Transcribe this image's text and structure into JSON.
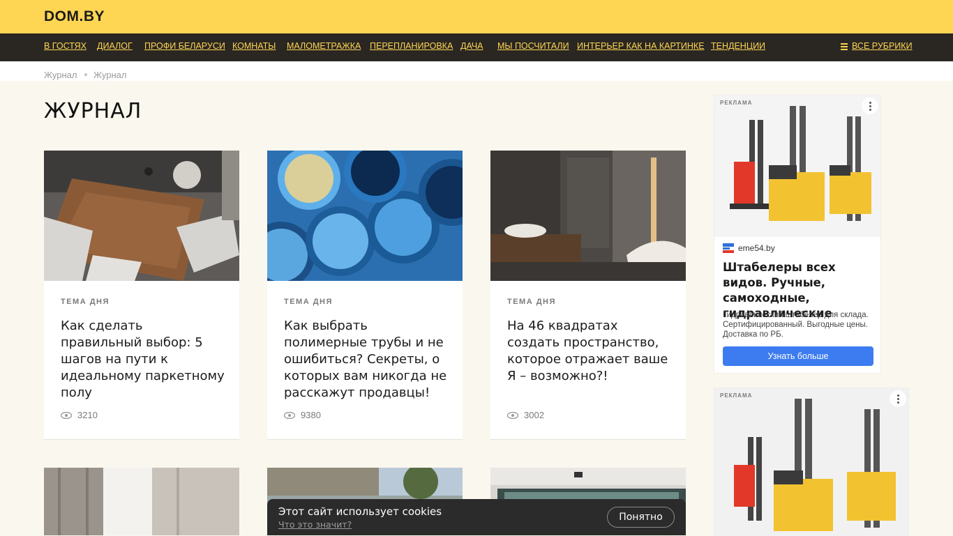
{
  "header": {
    "logo": "DOM.BY"
  },
  "nav": {
    "items": [
      {
        "label": "В ГОСТЯХ"
      },
      {
        "label": "ДИАЛОГ"
      },
      {
        "label": "ПРОФИ БЕЛАРУСИ"
      },
      {
        "label": "КОМНАТЫ"
      },
      {
        "label": "МАЛОМЕТРАЖКА"
      },
      {
        "label": "ПЕРЕПЛАНИРОВКА"
      },
      {
        "label": "ДАЧА"
      },
      {
        "label": "МЫ ПОСЧИТАЛИ"
      },
      {
        "label": "ИНТЕРЬЕР КАК НА КАРТИНКЕ"
      },
      {
        "label": "ТЕНДЕНЦИИ"
      }
    ],
    "all_rubrics": "ВСЕ РУБРИКИ"
  },
  "breadcrumb": [
    "Журнал",
    "Журнал"
  ],
  "page_title": "ЖУРНАЛ",
  "cards": [
    {
      "tag": "ТЕМА ДНЯ",
      "title": "Как сделать правильный выбор: 5 шагов на пути к идеальному паркетному полу",
      "views": "3210"
    },
    {
      "tag": "ТЕМА ДНЯ",
      "title": "Как выбрать полимерные трубы и не ошибиться? Секреты, о которых вам никогда не расскажут продавцы!",
      "views": "9380"
    },
    {
      "tag": "ТЕМА ДНЯ",
      "title": "На 46 квадратах создать пространство, которое отражает ваше Я – возможно?!",
      "views": "3002"
    }
  ],
  "ads": [
    {
      "label": "РЕКЛАМА",
      "domain": "eme54.by",
      "headline": "Штабелеры всех видов. Ручные, самоходные, гидравлические",
      "text": "Гидравлический штабелер для склада. Сертифицированный. Выгодные цены. Доставка по РБ.",
      "button": "Узнать больше"
    },
    {
      "label": "РЕКЛАМА"
    }
  ],
  "cookie": {
    "text": "Этот сайт использует cookies",
    "link": "Что это значит?",
    "button": "Понятно"
  },
  "colors": {
    "accent": "#ffd653",
    "nav_bg": "#2a2622",
    "page_bg": "#faf7ee",
    "ad_button": "#3c7cf0"
  }
}
